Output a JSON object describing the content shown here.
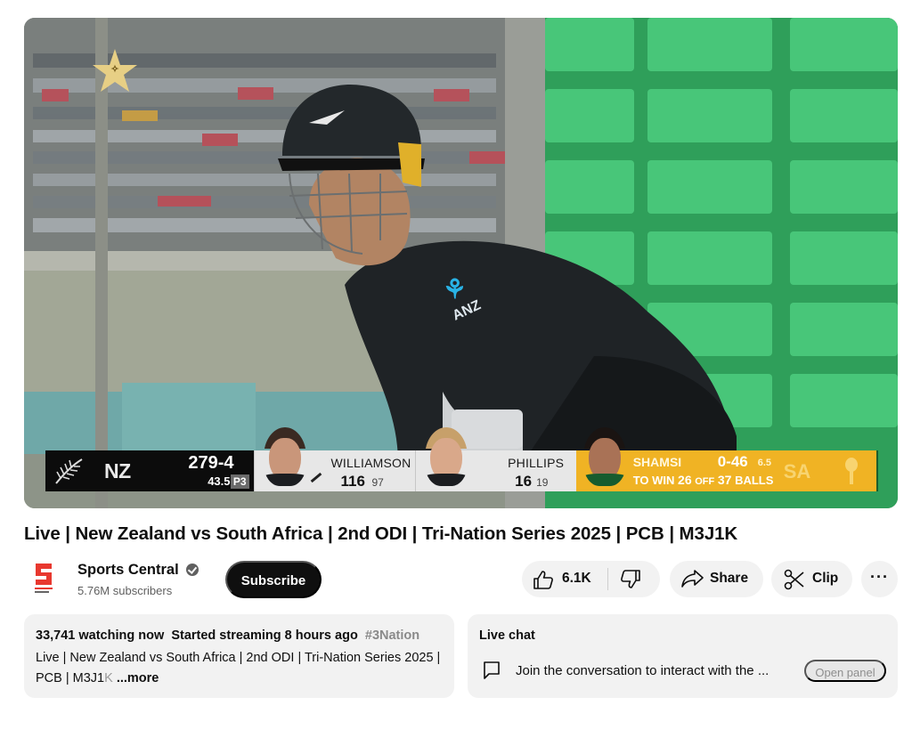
{
  "player": {
    "scoreboard": {
      "batting_team": "NZ",
      "score": "279-4",
      "overs": "43.5",
      "powerplay": "P3",
      "batsman1": {
        "name": "WILLIAMSON",
        "runs": "116",
        "balls": "97"
      },
      "batsman2": {
        "name": "PHILLIPS",
        "runs": "16",
        "balls": "19"
      },
      "bowler": {
        "name": "SHAMSI",
        "figures": "0-46",
        "overs": "6.5"
      },
      "target": {
        "prefix": "TO WIN",
        "runs": "26",
        "off": "OFF",
        "balls": "37",
        "suffix": "BALLS"
      },
      "bowling_team": "SA"
    },
    "colors": {
      "nz_panel": "#0c0c0c",
      "batsman_panel": "#e7e7e7",
      "bowler_panel": "#f0b324",
      "stadium_green": "#3db06b"
    }
  },
  "video": {
    "title": "Live | New Zealand vs South Africa | 2nd ODI | Tri-Nation Series 2025 | PCB | M3J1K"
  },
  "channel": {
    "name": "Sports Central",
    "subscribers": "5.76M subscribers",
    "subscribe_label": "Subscribe",
    "verified_icon": "check-circle-icon"
  },
  "actions": {
    "likes": "6.1K",
    "share_label": "Share",
    "clip_label": "Clip",
    "more_label": "···"
  },
  "description": {
    "viewers": "33,741 watching now",
    "started": "Started streaming 8 hours ago",
    "hashtag": "#3Nation",
    "text": "Live | New Zealand vs South Africa | 2nd ODI | Tri-Nation Series 2025 | PCB | M3J1",
    "text_faded": "K",
    "more_label": "...more"
  },
  "chat": {
    "title": "Live chat",
    "prompt": "Join the conversation to interact with the ...",
    "open_label": "Open panel"
  }
}
